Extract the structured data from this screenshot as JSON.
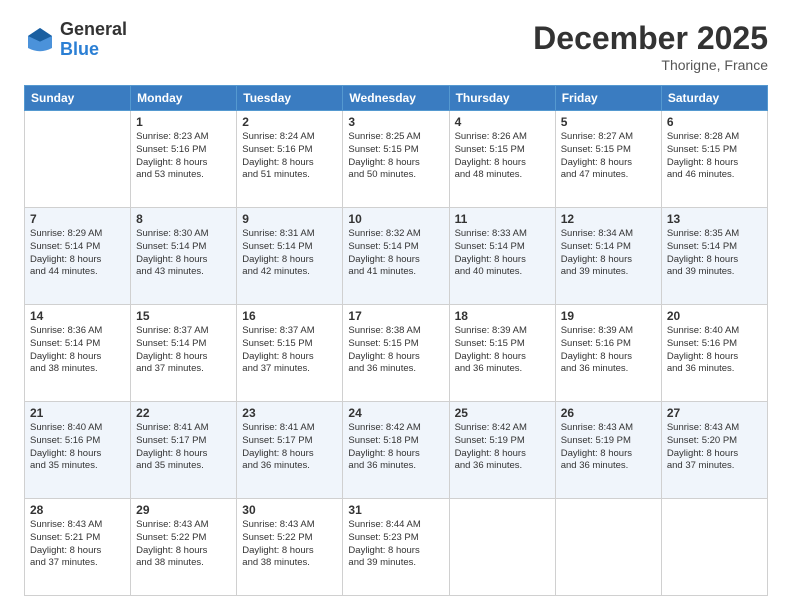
{
  "logo": {
    "general": "General",
    "blue": "Blue"
  },
  "header": {
    "month": "December 2025",
    "location": "Thorigne, France"
  },
  "days_of_week": [
    "Sunday",
    "Monday",
    "Tuesday",
    "Wednesday",
    "Thursday",
    "Friday",
    "Saturday"
  ],
  "weeks": [
    [
      {
        "day": "",
        "info": ""
      },
      {
        "day": "1",
        "info": "Sunrise: 8:23 AM\nSunset: 5:16 PM\nDaylight: 8 hours\nand 53 minutes."
      },
      {
        "day": "2",
        "info": "Sunrise: 8:24 AM\nSunset: 5:16 PM\nDaylight: 8 hours\nand 51 minutes."
      },
      {
        "day": "3",
        "info": "Sunrise: 8:25 AM\nSunset: 5:15 PM\nDaylight: 8 hours\nand 50 minutes."
      },
      {
        "day": "4",
        "info": "Sunrise: 8:26 AM\nSunset: 5:15 PM\nDaylight: 8 hours\nand 48 minutes."
      },
      {
        "day": "5",
        "info": "Sunrise: 8:27 AM\nSunset: 5:15 PM\nDaylight: 8 hours\nand 47 minutes."
      },
      {
        "day": "6",
        "info": "Sunrise: 8:28 AM\nSunset: 5:15 PM\nDaylight: 8 hours\nand 46 minutes."
      }
    ],
    [
      {
        "day": "7",
        "info": "Sunrise: 8:29 AM\nSunset: 5:14 PM\nDaylight: 8 hours\nand 44 minutes."
      },
      {
        "day": "8",
        "info": "Sunrise: 8:30 AM\nSunset: 5:14 PM\nDaylight: 8 hours\nand 43 minutes."
      },
      {
        "day": "9",
        "info": "Sunrise: 8:31 AM\nSunset: 5:14 PM\nDaylight: 8 hours\nand 42 minutes."
      },
      {
        "day": "10",
        "info": "Sunrise: 8:32 AM\nSunset: 5:14 PM\nDaylight: 8 hours\nand 41 minutes."
      },
      {
        "day": "11",
        "info": "Sunrise: 8:33 AM\nSunset: 5:14 PM\nDaylight: 8 hours\nand 40 minutes."
      },
      {
        "day": "12",
        "info": "Sunrise: 8:34 AM\nSunset: 5:14 PM\nDaylight: 8 hours\nand 39 minutes."
      },
      {
        "day": "13",
        "info": "Sunrise: 8:35 AM\nSunset: 5:14 PM\nDaylight: 8 hours\nand 39 minutes."
      }
    ],
    [
      {
        "day": "14",
        "info": "Sunrise: 8:36 AM\nSunset: 5:14 PM\nDaylight: 8 hours\nand 38 minutes."
      },
      {
        "day": "15",
        "info": "Sunrise: 8:37 AM\nSunset: 5:14 PM\nDaylight: 8 hours\nand 37 minutes."
      },
      {
        "day": "16",
        "info": "Sunrise: 8:37 AM\nSunset: 5:15 PM\nDaylight: 8 hours\nand 37 minutes."
      },
      {
        "day": "17",
        "info": "Sunrise: 8:38 AM\nSunset: 5:15 PM\nDaylight: 8 hours\nand 36 minutes."
      },
      {
        "day": "18",
        "info": "Sunrise: 8:39 AM\nSunset: 5:15 PM\nDaylight: 8 hours\nand 36 minutes."
      },
      {
        "day": "19",
        "info": "Sunrise: 8:39 AM\nSunset: 5:16 PM\nDaylight: 8 hours\nand 36 minutes."
      },
      {
        "day": "20",
        "info": "Sunrise: 8:40 AM\nSunset: 5:16 PM\nDaylight: 8 hours\nand 36 minutes."
      }
    ],
    [
      {
        "day": "21",
        "info": "Sunrise: 8:40 AM\nSunset: 5:16 PM\nDaylight: 8 hours\nand 35 minutes."
      },
      {
        "day": "22",
        "info": "Sunrise: 8:41 AM\nSunset: 5:17 PM\nDaylight: 8 hours\nand 35 minutes."
      },
      {
        "day": "23",
        "info": "Sunrise: 8:41 AM\nSunset: 5:17 PM\nDaylight: 8 hours\nand 36 minutes."
      },
      {
        "day": "24",
        "info": "Sunrise: 8:42 AM\nSunset: 5:18 PM\nDaylight: 8 hours\nand 36 minutes."
      },
      {
        "day": "25",
        "info": "Sunrise: 8:42 AM\nSunset: 5:19 PM\nDaylight: 8 hours\nand 36 minutes."
      },
      {
        "day": "26",
        "info": "Sunrise: 8:43 AM\nSunset: 5:19 PM\nDaylight: 8 hours\nand 36 minutes."
      },
      {
        "day": "27",
        "info": "Sunrise: 8:43 AM\nSunset: 5:20 PM\nDaylight: 8 hours\nand 37 minutes."
      }
    ],
    [
      {
        "day": "28",
        "info": "Sunrise: 8:43 AM\nSunset: 5:21 PM\nDaylight: 8 hours\nand 37 minutes."
      },
      {
        "day": "29",
        "info": "Sunrise: 8:43 AM\nSunset: 5:22 PM\nDaylight: 8 hours\nand 38 minutes."
      },
      {
        "day": "30",
        "info": "Sunrise: 8:43 AM\nSunset: 5:22 PM\nDaylight: 8 hours\nand 38 minutes."
      },
      {
        "day": "31",
        "info": "Sunrise: 8:44 AM\nSunset: 5:23 PM\nDaylight: 8 hours\nand 39 minutes."
      },
      {
        "day": "",
        "info": ""
      },
      {
        "day": "",
        "info": ""
      },
      {
        "day": "",
        "info": ""
      }
    ]
  ]
}
